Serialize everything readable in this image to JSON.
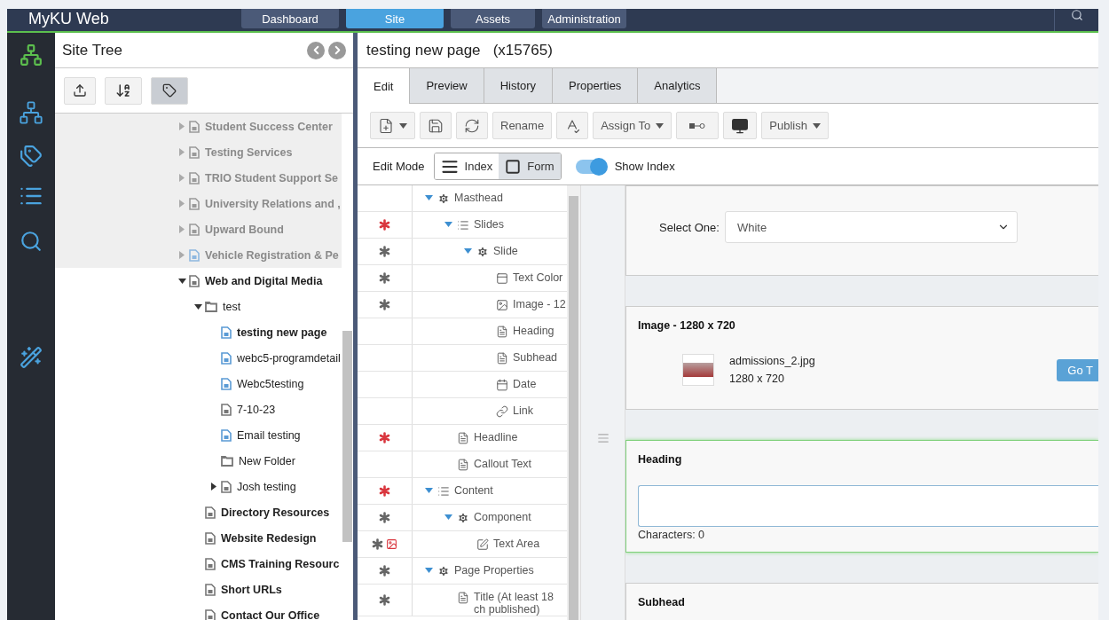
{
  "top_nav": {
    "brand": "MyKU Web",
    "tabs": [
      {
        "label": "Dashboard",
        "selected": false
      },
      {
        "label": "Site",
        "selected": true
      },
      {
        "label": "Assets",
        "selected": false
      },
      {
        "label": "Administration",
        "selected": false
      }
    ]
  },
  "rail": [
    {
      "kind": "sitemap",
      "selected": true
    },
    {
      "kind": "sitemap-boxes",
      "selected": false
    },
    {
      "kind": "tags",
      "selected": false
    },
    {
      "kind": "list",
      "selected": false
    },
    {
      "kind": "search",
      "selected": false
    },
    {
      "kind": "wand",
      "selected": false
    }
  ],
  "site_tree": {
    "title": "Site Tree",
    "tools": [
      {
        "kind": "publish",
        "selected": false
      },
      {
        "kind": "sort",
        "selected": false
      },
      {
        "kind": "tag",
        "selected": true
      }
    ],
    "items": [
      {
        "label": "Student Success Center",
        "kind": "page",
        "bold": true,
        "dimmed": true,
        "color": "#9a9a9a",
        "expanded": false
      },
      {
        "label": "Testing Services",
        "kind": "page",
        "bold": true,
        "dimmed": true,
        "color": "#9a9a9a",
        "expanded": false
      },
      {
        "label": "TRIO Student Support Se",
        "kind": "page",
        "bold": true,
        "dimmed": true,
        "color": "#9a9a9a",
        "expanded": false
      },
      {
        "label": "University Relations and ,",
        "kind": "page",
        "bold": true,
        "dimmed": true,
        "color": "#9a9a9a",
        "expanded": false
      },
      {
        "label": "Upward Bound",
        "kind": "page",
        "bold": true,
        "dimmed": true,
        "color": "#9a9a9a",
        "expanded": false
      },
      {
        "label": "Vehicle Registration & Pe",
        "kind": "page",
        "bold": true,
        "dimmed": true,
        "color": "#8fb8e0",
        "expanded": false
      },
      {
        "label": "Web and Digital Media",
        "kind": "page",
        "bold": true,
        "dimmed": false,
        "color": "#777777",
        "expanded": true,
        "children": [
          {
            "label": "test",
            "kind": "folder",
            "bold": false,
            "dimmed": false,
            "color": "#777777",
            "expanded": true,
            "children": [
              {
                "label": "testing new page",
                "kind": "page",
                "bold": true,
                "dimmed": false,
                "color": "#5b9bd5"
              },
              {
                "label": "webc5-programdetail",
                "kind": "page",
                "bold": false,
                "dimmed": false,
                "color": "#5b9bd5"
              },
              {
                "label": "Webc5testing",
                "kind": "page",
                "bold": false,
                "dimmed": false,
                "color": "#5b9bd5"
              },
              {
                "label": "7-10-23",
                "kind": "page",
                "bold": false,
                "dimmed": false,
                "color": "#777777"
              },
              {
                "label": "Email testing",
                "kind": "page",
                "bold": false,
                "dimmed": false,
                "color": "#5b9bd5"
              },
              {
                "label": "New Folder",
                "kind": "folder",
                "bold": false,
                "dimmed": false,
                "color": "#777777"
              },
              {
                "label": "Josh testing",
                "kind": "page",
                "bold": false,
                "dimmed": false,
                "color": "#777777",
                "expanded": false
              }
            ]
          },
          {
            "label": "Directory Resources",
            "kind": "page",
            "bold": true,
            "dimmed": false,
            "color": "#777777"
          },
          {
            "label": "Website Redesign",
            "kind": "page",
            "bold": true,
            "dimmed": false,
            "color": "#777777"
          },
          {
            "label": "CMS Training Resourc",
            "kind": "page",
            "bold": true,
            "dimmed": false,
            "color": "#777777"
          },
          {
            "label": "Short URLs",
            "kind": "page",
            "bold": true,
            "dimmed": false,
            "color": "#777777"
          },
          {
            "label": "Contact Our Office",
            "kind": "page",
            "bold": true,
            "dimmed": false,
            "color": "#777777"
          }
        ]
      }
    ]
  },
  "page": {
    "title": "testing new page",
    "id": "(x15765)",
    "tabs": [
      {
        "label": "Edit",
        "selected": true
      },
      {
        "label": "Preview",
        "selected": false
      },
      {
        "label": "History",
        "selected": false
      },
      {
        "label": "Properties",
        "selected": false
      },
      {
        "label": "Analytics",
        "selected": false
      }
    ],
    "toolbar": [
      {
        "kind": "new-page"
      },
      {
        "kind": "save"
      },
      {
        "kind": "refresh"
      },
      {
        "kind": "text",
        "label": "Rename"
      },
      {
        "kind": "spellcheck"
      },
      {
        "kind": "text-menu",
        "label": "Assign To"
      },
      {
        "kind": "connector"
      },
      {
        "kind": "monitor"
      },
      {
        "kind": "text-menu",
        "label": "Publish"
      }
    ],
    "edit_mode": {
      "label": "Edit Mode",
      "options": [
        {
          "label": "Index",
          "kind": "index",
          "selected": false
        },
        {
          "label": "Form",
          "kind": "form",
          "selected": true
        }
      ],
      "toggle": {
        "label": "Show Index",
        "on": true
      }
    },
    "index": [
      {
        "label": "Masthead",
        "kind": "gear",
        "expanded": true,
        "children": [
          {
            "label": "Slides",
            "kind": "list",
            "asterisk": {
              "color": "#d9363e"
            },
            "expanded": true,
            "children": [
              {
                "label": "Slide",
                "kind": "gear",
                "asterisk": {
                  "color": "#666666"
                },
                "expanded": true,
                "children": [
                  {
                    "label": "Text Color",
                    "kind": "text-color",
                    "asterisk": {
                      "color": "#666666"
                    }
                  },
                  {
                    "label": "Image - 12",
                    "kind": "image",
                    "asterisk": {
                      "color": "#666666"
                    }
                  },
                  {
                    "label": "Heading",
                    "kind": "document"
                  },
                  {
                    "label": "Subhead",
                    "kind": "document"
                  },
                  {
                    "label": "Date",
                    "kind": "calendar"
                  },
                  {
                    "label": "Link",
                    "kind": "link"
                  }
                ]
              }
            ]
          },
          {
            "label": "Headline",
            "kind": "document",
            "asterisk": {
              "color": "#d9363e"
            }
          },
          {
            "label": "Callout Text",
            "kind": "document"
          }
        ]
      },
      {
        "label": "Content",
        "kind": "list",
        "asterisk": {
          "color": "#d9363e"
        },
        "expanded": true,
        "children": [
          {
            "label": "Component",
            "kind": "gear",
            "asterisk": {
              "color": "#666666"
            },
            "expanded": true,
            "children": [
              {
                "label": "Text Area",
                "kind": "edit",
                "asterisk": {
                  "color": "#666666"
                },
                "image_flag": true
              }
            ]
          }
        ]
      },
      {
        "label": "Page Properties",
        "kind": "gear",
        "asterisk": {
          "color": "#666666"
        },
        "expanded": true,
        "children": [
          {
            "label": "Title (At least 18 ch published)",
            "kind": "document",
            "asterisk": {
              "color": "#666666"
            }
          }
        ]
      }
    ],
    "form": [
      {
        "kind": "select",
        "label": "Select One:",
        "value": "White"
      },
      {
        "kind": "image",
        "title": "Image - 1280 x 720",
        "file": "admissions_2.jpg",
        "size": "1280 x 720",
        "button": "Go T"
      },
      {
        "kind": "textarea",
        "title": "Heading",
        "active": true,
        "counter": "Characters: 0"
      },
      {
        "kind": "heading",
        "title": "Subhead"
      }
    ]
  }
}
